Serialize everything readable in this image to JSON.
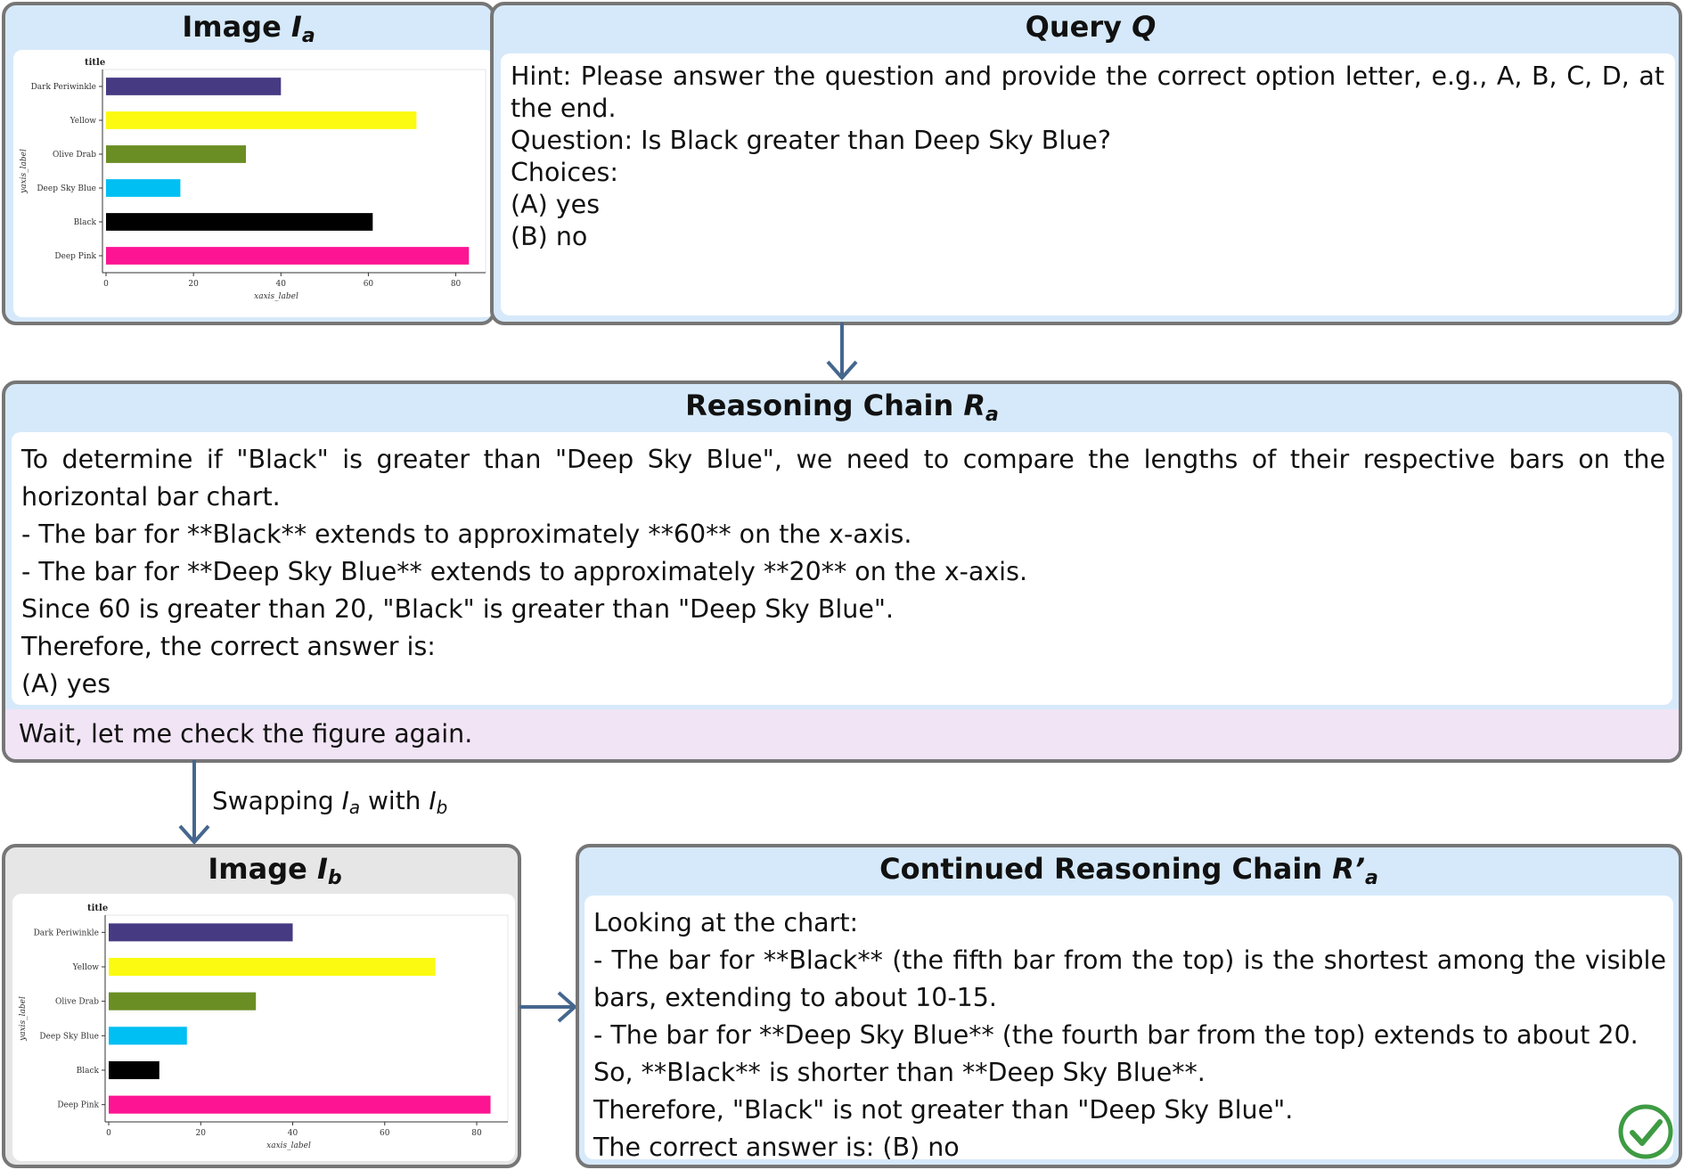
{
  "panels": {
    "image_a": {
      "title": "Image ",
      "symbol": "I",
      "sub": "a"
    },
    "query": {
      "title": "Query ",
      "symbol": "Q",
      "lines": [
        "Hint: Please answer the question and provide the correct option letter, e.g., A, B, C, D, at the end.",
        "Question: Is Black greater than Deep Sky Blue?",
        "Choices:",
        "(A) yes",
        "(B) no"
      ]
    },
    "reasoning": {
      "title": "Reasoning Chain ",
      "symbol": "R",
      "sub": "a",
      "lines": [
        "To determine if \"Black\" is greater than \"Deep Sky Blue\", we need to compare the lengths of their respective bars on the horizontal bar chart.",
        "- The bar for **Black** extends to approximately **60** on the x-axis.",
        "- The bar for **Deep Sky Blue** extends to approximately **20** on the x-axis.",
        "Since 60 is greater than 20, \"Black\" is greater than \"Deep Sky Blue\".",
        "Therefore, the correct answer is:",
        "(A) yes"
      ],
      "reflection": "Wait, let me check the figure again."
    },
    "image_b": {
      "title": "Image ",
      "symbol": "I",
      "sub": "b"
    },
    "continued": {
      "title": "Continued Reasoning Chain ",
      "symbol": "R’",
      "sub": "a",
      "lines": [
        "Looking at the chart:",
        "- The bar for **Black** (the fifth bar from the top) is the shortest among the visible bars, extending to about 10-15.",
        "- The bar for **Deep Sky Blue** (the fourth bar from the top) extends to about 20.",
        "So, **Black** is shorter than **Deep Sky Blue**.",
        "Therefore, \"Black\" is not greater than \"Deep Sky Blue\".",
        "The correct answer is: (B) no"
      ]
    }
  },
  "swap_label": {
    "prefix": "Swapping ",
    "sym1": "I",
    "sub1": "a",
    "mid": " with ",
    "sym2": "I",
    "sub2": "b"
  },
  "colors": {
    "check": "#3e9b43",
    "arrow": "#45678e",
    "border": "#767676"
  },
  "chart_data": [
    {
      "type": "bar",
      "orientation": "horizontal",
      "title": "title",
      "xlabel": "xaxis_label",
      "ylabel": "yaxis_label",
      "categories": [
        "Dark Periwinkle",
        "Yellow",
        "Olive Drab",
        "Deep Sky Blue",
        "Black",
        "Deep Pink"
      ],
      "values": [
        40,
        71,
        32,
        17,
        61,
        83
      ],
      "colors": [
        "#463b83",
        "#fbfa10",
        "#6a8e23",
        "#00bff3",
        "#000000",
        "#fd1493"
      ],
      "xticks": [
        0,
        20,
        40,
        60,
        80
      ],
      "xlim": [
        0,
        86
      ]
    },
    {
      "type": "bar",
      "orientation": "horizontal",
      "title": "title",
      "xlabel": "xaxis_label",
      "ylabel": "yaxis_label",
      "categories": [
        "Dark Periwinkle",
        "Yellow",
        "Olive Drab",
        "Deep Sky Blue",
        "Black",
        "Deep Pink"
      ],
      "values": [
        40,
        71,
        32,
        17,
        11,
        83
      ],
      "colors": [
        "#463b83",
        "#fbfa10",
        "#6a8e23",
        "#00bff3",
        "#000000",
        "#fd1493"
      ],
      "xticks": [
        0,
        20,
        40,
        60,
        80
      ],
      "xlim": [
        0,
        86
      ]
    }
  ]
}
